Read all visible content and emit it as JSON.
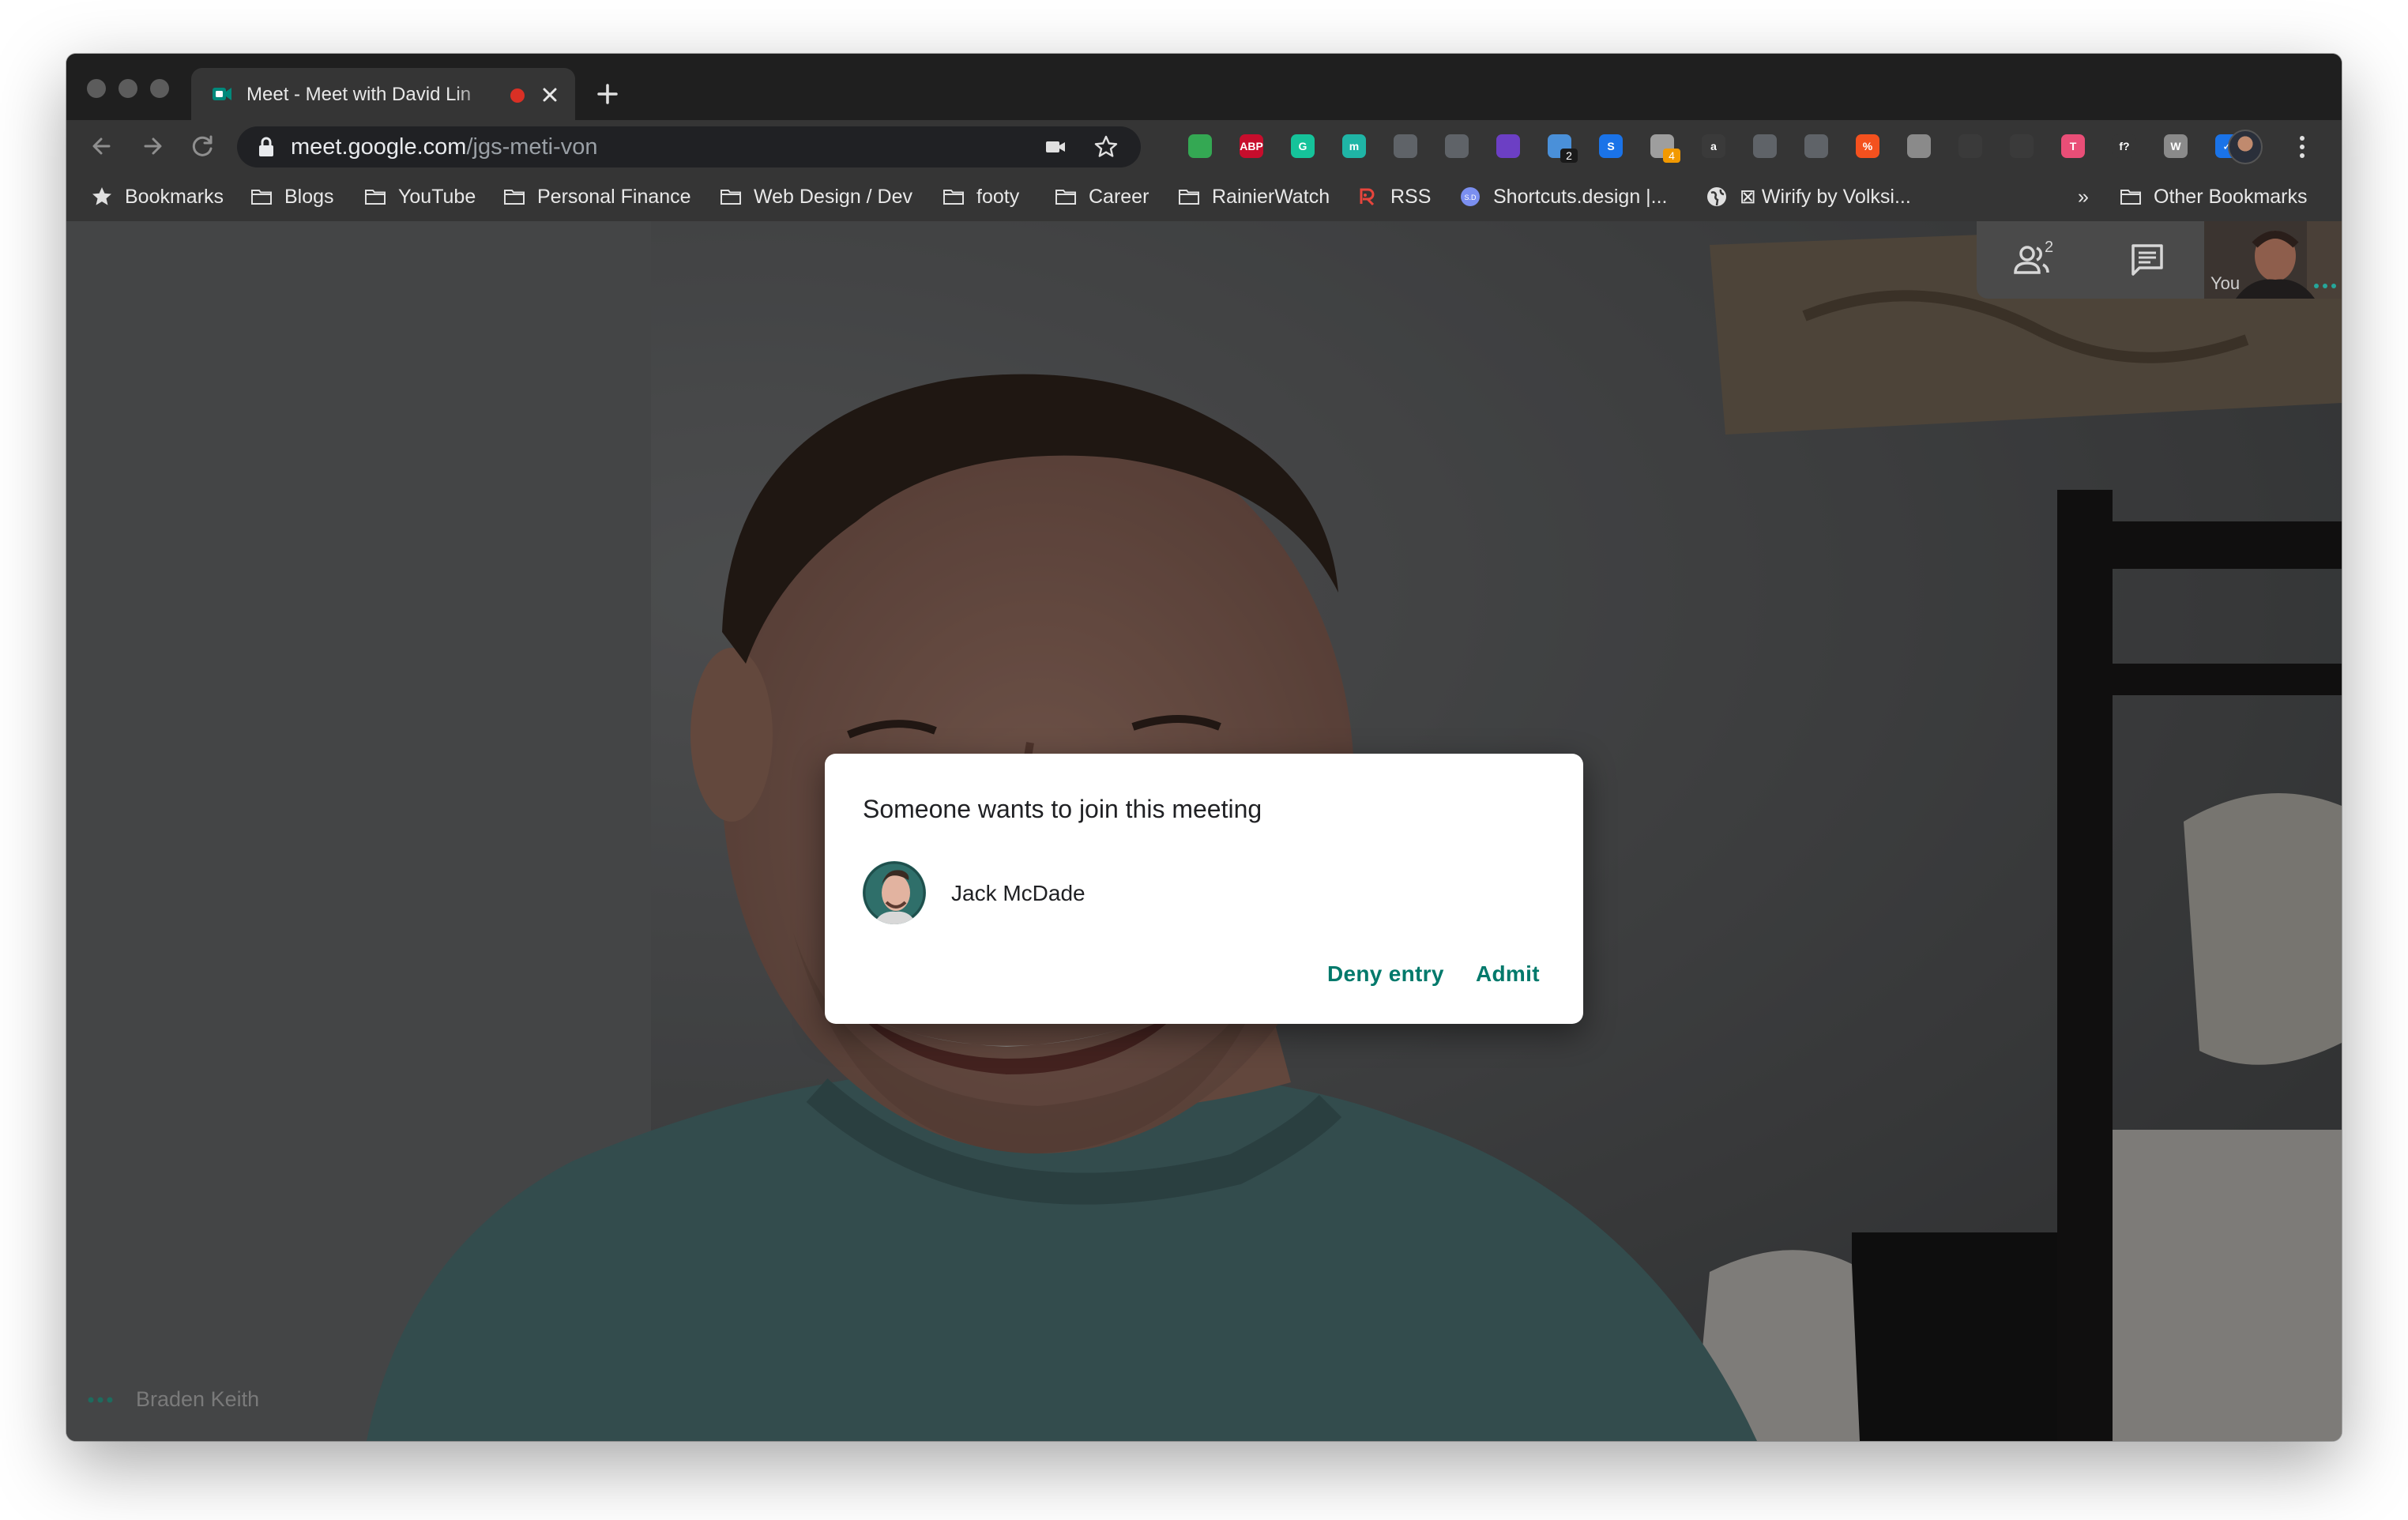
{
  "browser": {
    "tab_title": "Meet - Meet with David Lin",
    "url_domain": "meet.google.com",
    "url_path": "/jgs-meti-von"
  },
  "extensions": [
    {
      "name": "extension-green-icon",
      "color": "#34a853",
      "text": ""
    },
    {
      "name": "adblock-plus-icon",
      "color": "#c70d2c",
      "text": "ABP"
    },
    {
      "name": "grammarly-icon",
      "color": "#15c39a",
      "text": "G"
    },
    {
      "name": "extension-teal-icon",
      "color": "#1fb5a6",
      "text": "m"
    },
    {
      "name": "extension-grey-circle-icon",
      "color": "#5f6368",
      "text": ""
    },
    {
      "name": "pocket-icon",
      "color": "#5f6368",
      "text": ""
    },
    {
      "name": "extension-purple-icon",
      "color": "#6c3fc4",
      "text": ""
    },
    {
      "name": "extension-badge-2-icon",
      "color": "#4a90d9",
      "text": "",
      "badge": "2"
    },
    {
      "name": "extension-blue-s-icon",
      "color": "#1a73e8",
      "text": "S"
    },
    {
      "name": "extension-badge-4-icon",
      "color": "#9e9e9e",
      "text": "",
      "badge": "4"
    },
    {
      "name": "amazon-icon",
      "color": "#3a3a3a",
      "text": "a"
    },
    {
      "name": "extension-gear-icon",
      "color": "#5f6368",
      "text": ""
    },
    {
      "name": "extension-hat-icon",
      "color": "#5f6368",
      "text": ""
    },
    {
      "name": "extension-orange-icon",
      "color": "#f4511e",
      "text": "%"
    },
    {
      "name": "extension-grey-square-icon",
      "color": "#8a8a8a",
      "text": ""
    },
    {
      "name": "react-devtools-icon",
      "color": "#3a3a3a",
      "text": ""
    },
    {
      "name": "extension-target-icon",
      "color": "#3a3a3a",
      "text": ""
    },
    {
      "name": "extension-pink-icon",
      "color": "#e94e77",
      "text": "T"
    },
    {
      "name": "whatfont-icon",
      "color": "#353535",
      "text": "f?"
    },
    {
      "name": "extension-w-icon",
      "color": "#8a8a8a",
      "text": "W"
    },
    {
      "name": "extension-checkbox-icon",
      "color": "#1a73e8",
      "text": "✓"
    }
  ],
  "bookmarks": [
    {
      "label": "Bookmarks",
      "icon": "star-icon"
    },
    {
      "label": "Blogs",
      "icon": "folder-icon"
    },
    {
      "label": "YouTube",
      "icon": "folder-icon"
    },
    {
      "label": "Personal Finance",
      "icon": "folder-icon"
    },
    {
      "label": "Web Design / Dev",
      "icon": "folder-icon"
    },
    {
      "label": "footy",
      "icon": "folder-icon"
    },
    {
      "label": "Career",
      "icon": "folder-icon"
    },
    {
      "label": "RainierWatch",
      "icon": "folder-icon"
    },
    {
      "label": "RSS",
      "icon": "rss-icon"
    },
    {
      "label": "Shortcuts.design |...",
      "icon": "shortcuts-icon"
    },
    {
      "label": "⊠ Wirify by Volksi...",
      "icon": "globe-icon"
    },
    {
      "label": "»",
      "icon": ""
    },
    {
      "label": "Other Bookmarks",
      "icon": "folder-icon"
    }
  ],
  "meet": {
    "people_count": "2",
    "self_label": "You",
    "presenter_name": "Braden Keith",
    "accent_color": "#00796b"
  },
  "dialog": {
    "title": "Someone wants to join this meeting",
    "requester_name": "Jack McDade",
    "deny_label": "Deny entry",
    "admit_label": "Admit"
  }
}
